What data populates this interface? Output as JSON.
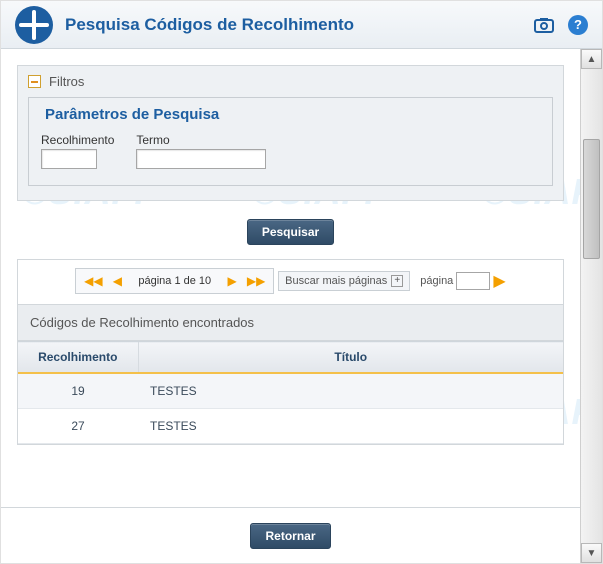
{
  "header": {
    "title": "Pesquisa Códigos de Recolhimento"
  },
  "filters": {
    "section_label": "Filtros",
    "fieldset_title": "Parâmetros de Pesquisa",
    "recolhimento_label": "Recolhimento",
    "recolhimento_value": "",
    "termo_label": "Termo",
    "termo_value": ""
  },
  "buttons": {
    "search": "Pesquisar",
    "return": "Retornar",
    "more_pages": "Buscar mais páginas"
  },
  "pager": {
    "text": "página 1 de 10",
    "goto_label": "página",
    "goto_value": ""
  },
  "results": {
    "title": "Códigos de Recolhimento encontrados",
    "columns": {
      "c1": "Recolhimento",
      "c2": "Título"
    },
    "rows": [
      {
        "code": "19",
        "title": "TESTES"
      },
      {
        "code": "27",
        "title": "TESTES"
      }
    ]
  },
  "watermark": "©SIAFI"
}
